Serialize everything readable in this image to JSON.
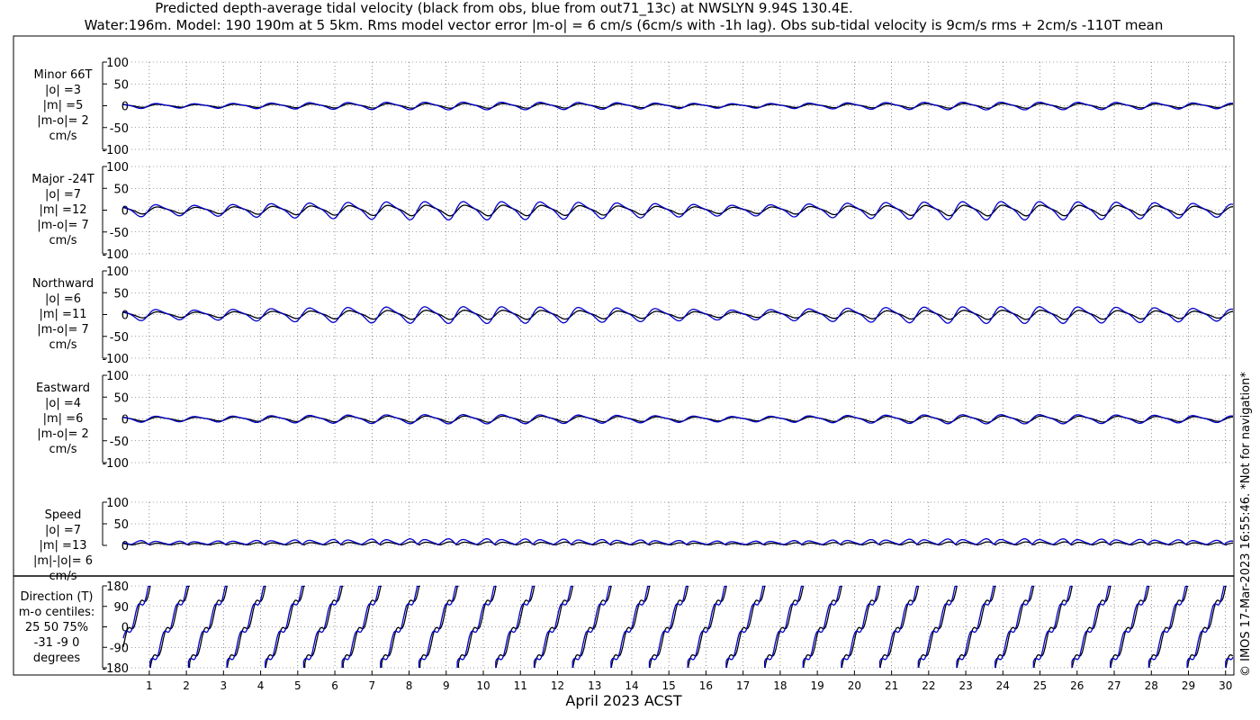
{
  "chart_data": {
    "type": "line",
    "title_line1": "Predicted depth-average tidal velocity (black from obs, blue from out71_13c) at NWSLYN 9.94S 130.4E.",
    "title_line2": "Water:196m. Model: 190 190m at 5 5km. Rms model vector error |m-o| = 6 cm/s (6cm/s with -1h lag). Obs sub-tidal velocity is 9cm/s rms + 2cm/s -110T mean",
    "xlabel": "April 2023 ACST",
    "x_ticks": [
      "1",
      "2",
      "3",
      "4",
      "5",
      "6",
      "7",
      "8",
      "9",
      "10",
      "11",
      "12",
      "13",
      "14",
      "15",
      "16",
      "17",
      "18",
      "19",
      "20",
      "21",
      "22",
      "23",
      "24",
      "25",
      "26",
      "27",
      "28",
      "29",
      "30"
    ],
    "xlim": [
      0.3,
      30.2
    ],
    "series_colors": {
      "obs": "#000000",
      "model": "#0000cc"
    },
    "credit": "© IMOS 17-Mar-2023 16:55:46. *Not for navigation*",
    "panels": [
      {
        "id": "minor",
        "labels": [
          "Minor 66T",
          "|o| =3",
          "|m| =5",
          "|m-o|= 2",
          "cm/s"
        ],
        "ylim": [
          -100,
          100
        ],
        "y_ticks": [
          "100",
          "50",
          "0",
          "-50",
          "-100"
        ],
        "obs_amplitude": 3,
        "model_amplitude": 5
      },
      {
        "id": "major",
        "labels": [
          "Major -24T",
          "|o| =7",
          "|m| =12",
          "|m-o|= 7",
          "cm/s"
        ],
        "ylim": [
          -100,
          100
        ],
        "y_ticks": [
          "100",
          "50",
          "0",
          "-50",
          "-100"
        ],
        "obs_amplitude": 7,
        "model_amplitude": 12
      },
      {
        "id": "northward",
        "labels": [
          "Northward",
          "|o| =6",
          "|m| =11",
          "|m-o|= 7",
          "cm/s"
        ],
        "ylim": [
          -100,
          100
        ],
        "y_ticks": [
          "100",
          "50",
          "0",
          "-50",
          "-100"
        ],
        "obs_amplitude": 6,
        "model_amplitude": 11
      },
      {
        "id": "eastward",
        "labels": [
          "Eastward",
          "|o| =4",
          "|m| =6",
          "|m-o|= 2",
          "cm/s"
        ],
        "ylim": [
          -100,
          100
        ],
        "y_ticks": [
          "100",
          "50",
          "0",
          "-50",
          "-100"
        ],
        "obs_amplitude": 4,
        "model_amplitude": 6
      },
      {
        "id": "speed",
        "labels": [
          "Speed",
          "|o| =7",
          "|m| =13",
          "|m|-|o|= 6",
          "cm/s"
        ],
        "ylim": [
          0,
          100
        ],
        "y_ticks": [
          "100",
          "50",
          "0"
        ],
        "obs_amplitude": 7,
        "model_amplitude": 13
      }
    ],
    "direction_panel": {
      "labels": [
        "Direction (T)",
        "m-o centiles:",
        "25  50  75%",
        "-31  -9   0",
        "degrees"
      ],
      "ylim": [
        -180,
        180
      ],
      "y_ticks": [
        "180",
        "90",
        "0",
        "-90",
        "-180"
      ]
    }
  }
}
